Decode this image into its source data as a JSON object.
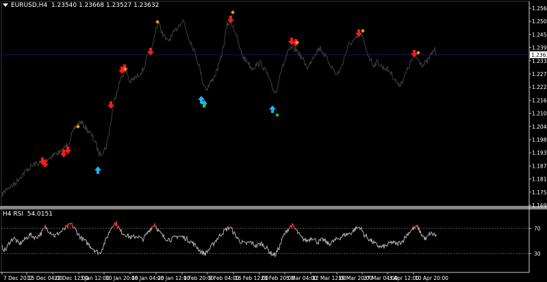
{
  "main_header": {
    "symbol": "EURUSD,H4",
    "ohlc": "1.23540 1.23668 1.23527 1.23632"
  },
  "rsi_header": {
    "label": "H4 RSI",
    "value": "54.0151"
  },
  "price_axis": [
    "1.25660",
    "1.25095",
    "1.24525",
    "1.23960",
    "1.23370",
    "1.22785",
    "1.22215",
    "1.21630",
    "1.21055",
    "1.20460",
    "1.19890",
    "1.19305",
    "1.18735",
    "1.18150",
    "1.17565",
    "1.16995"
  ],
  "current_price": "1.23632",
  "rsi_axis": [
    "70",
    "30"
  ],
  "time_axis": [
    "7 Dec 2017",
    "15 Dec 04:00",
    "22 Dec 12:00",
    "3 Jan 12:00",
    "10 Jan 20:00",
    "18 Jan 04:00",
    "25 Jan 12:00",
    "1 Feb 20:00",
    "9 Feb 04:00",
    "16 Feb 12:00",
    "23 Feb 20:00",
    "5 Mar 04:00",
    "12 Mar 12:00",
    "19 Mar 20:00",
    "27 Mar 04:00",
    "3 Apr 12:00",
    "10 Apr 20:00"
  ],
  "colors": {
    "price_line": "#34413f",
    "rsi_line": "#b4b4b4",
    "rsi_overbought": "#ff2a2a",
    "rsi_oversold": "#2adc2a",
    "sell_arrow": "#ff1a1a",
    "buy_arrow": "#1ab4ff",
    "sell_dot": "#ff9f00",
    "buy_dot": "#19d219",
    "grid": "#7a7a7a",
    "current_price_line": "#1a1a80"
  }
}
